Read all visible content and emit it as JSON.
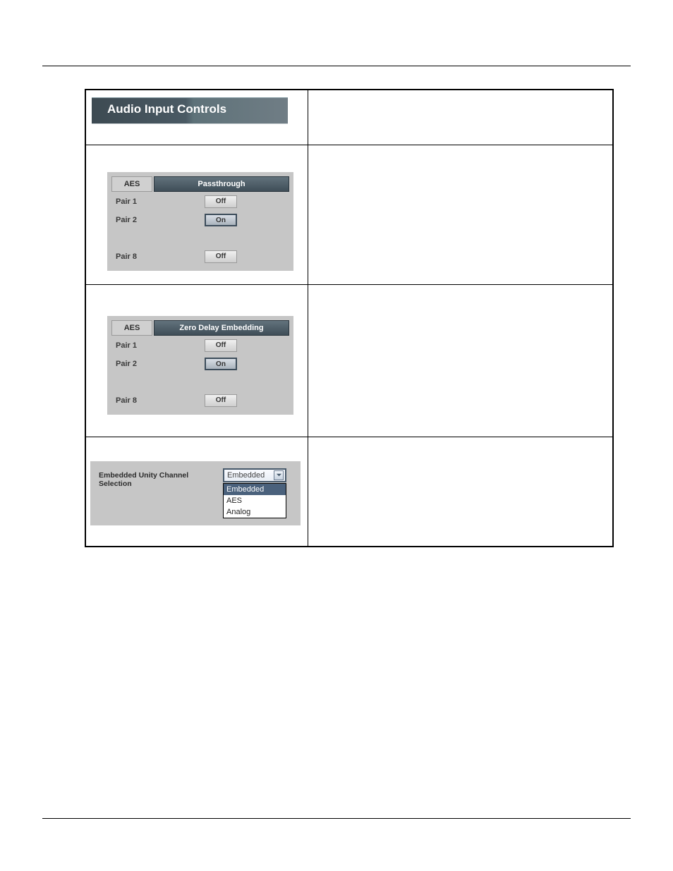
{
  "header_tab": "Audio Input Controls",
  "panel_a": {
    "col1_header": "AES",
    "col2_header": "Passthrough",
    "rows": {
      "pair1": {
        "label": "Pair 1",
        "state": "Off"
      },
      "pair2": {
        "label": "Pair 2",
        "state": "On"
      },
      "pair8": {
        "label": "Pair 8",
        "state": "Off"
      }
    }
  },
  "panel_b": {
    "col1_header": "AES",
    "col2_header": "Zero Delay Embedding",
    "rows": {
      "pair1": {
        "label": "Pair 1",
        "state": "Off"
      },
      "pair2": {
        "label": "Pair 2",
        "state": "On"
      },
      "pair8": {
        "label": "Pair 8",
        "state": "Off"
      }
    }
  },
  "embedded_unity": {
    "label": "Embedded Unity Channel Selection",
    "selected": "Embedded",
    "options": [
      "Embedded",
      "AES",
      "Analog"
    ]
  }
}
